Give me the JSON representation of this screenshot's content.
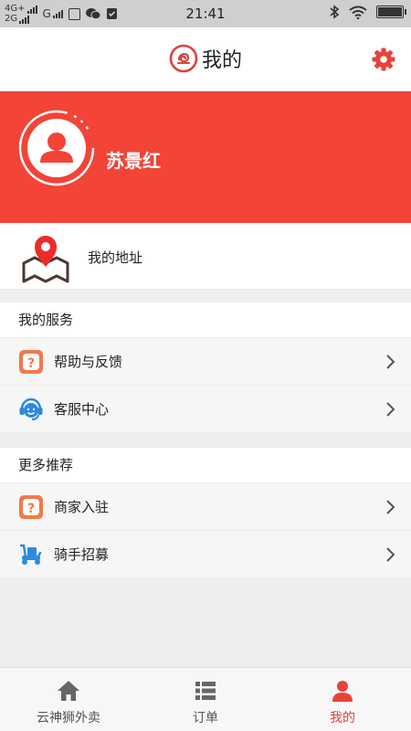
{
  "status_bar": {
    "net_top": "4G+",
    "net_bottom": "2G",
    "operator": "G",
    "time": "21:41"
  },
  "header": {
    "title": "我的",
    "icons": {
      "logo": "lion-logo-icon",
      "settings": "gear-icon"
    }
  },
  "profile": {
    "name": "苏景红",
    "icons": {
      "avatar": "avatar-icon"
    }
  },
  "address": {
    "label": "我的地址",
    "icon": "map-pin-icon"
  },
  "services": {
    "title": "我的服务",
    "items": [
      {
        "label": "帮助与反馈",
        "icon": "help-question-icon"
      },
      {
        "label": "客服中心",
        "icon": "customer-service-icon"
      }
    ]
  },
  "recommend": {
    "title": "更多推荐",
    "items": [
      {
        "label": "商家入驻",
        "icon": "help-question-icon"
      },
      {
        "label": "骑手招募",
        "icon": "scooter-icon"
      }
    ]
  },
  "bottom_nav": {
    "items": [
      {
        "label": "云神狮外卖",
        "icon": "home-icon",
        "active": false
      },
      {
        "label": "订单",
        "icon": "list-icon",
        "active": false
      },
      {
        "label": "我的",
        "icon": "user-icon",
        "active": true
      }
    ]
  },
  "colors": {
    "accent": "#f44337",
    "icon_orange": "#f07a4a",
    "icon_blue": "#2b8be0",
    "nav_active": "#e8423a",
    "status_bar_bg": "#cfcfcf"
  }
}
